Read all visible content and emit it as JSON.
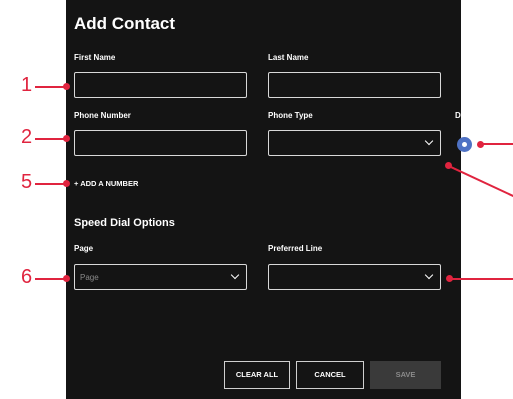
{
  "form": {
    "title": "Add Contact",
    "first_name_label": "First Name",
    "last_name_label": "Last Name",
    "phone_number_label": "Phone Number",
    "phone_type_label": "Phone Type",
    "default_label": "Default",
    "add_number_label": "ADD A NUMBER",
    "speed_dial_heading": "Speed Dial Options",
    "page_label": "Page",
    "page_placeholder": "Page",
    "preferred_line_label": "Preferred Line"
  },
  "buttons": {
    "clear_all": "CLEAR ALL",
    "cancel": "CANCEL",
    "save": "SAVE"
  },
  "callouts": {
    "c1": "1",
    "c2": "2",
    "c5": "5",
    "c6": "6"
  },
  "colors": {
    "panel": "#141414",
    "accent": "#4f72c4",
    "callout": "#e0243f"
  },
  "icons": {
    "plus": "plus-icon",
    "chevron": "chevron-down-icon"
  }
}
